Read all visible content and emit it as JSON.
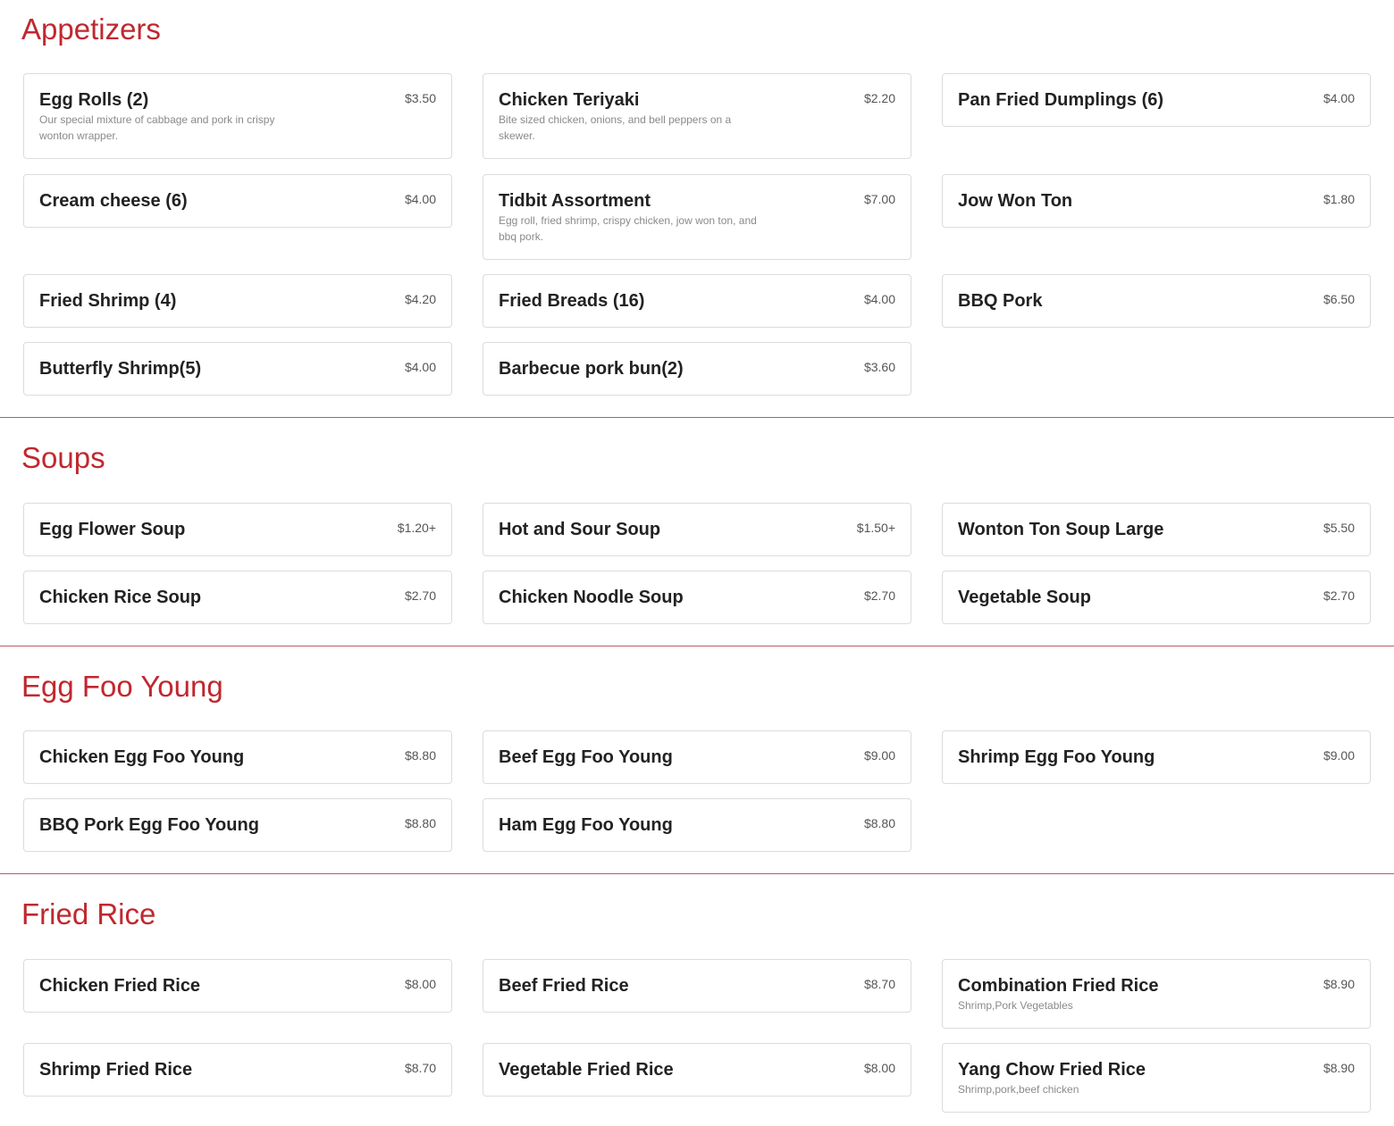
{
  "sections": {
    "appetizers": {
      "title": "Appetizers",
      "items": [
        {
          "name": "Egg Rolls (2)",
          "price": "$3.50",
          "desc": "Our special mixture of cabbage and pork in crispy wonton wrapper."
        },
        {
          "name": "Chicken Teriyaki",
          "price": "$2.20",
          "desc": "Bite sized chicken, onions, and bell peppers on a skewer."
        },
        {
          "name": "Pan Fried Dumplings (6)",
          "price": "$4.00"
        },
        {
          "name": "Cream cheese (6)",
          "price": "$4.00"
        },
        {
          "name": "Tidbit Assortment",
          "price": "$7.00",
          "desc": "Egg roll, fried shrimp, crispy chicken, jow won ton, and bbq pork."
        },
        {
          "name": "Jow Won Ton",
          "price": "$1.80"
        },
        {
          "name": "Fried Shrimp (4)",
          "price": "$4.20"
        },
        {
          "name": "Fried Breads (16)",
          "price": "$4.00"
        },
        {
          "name": "BBQ Pork",
          "price": "$6.50"
        },
        {
          "name": "Butterfly Shrimp(5)",
          "price": "$4.00"
        },
        {
          "name": "Barbecue pork bun(2)",
          "price": "$3.60"
        }
      ]
    },
    "soups": {
      "title": "Soups",
      "items": [
        {
          "name": "Egg Flower Soup",
          "price": "$1.20+"
        },
        {
          "name": "Hot and Sour Soup",
          "price": "$1.50+"
        },
        {
          "name": "Wonton Ton Soup Large",
          "price": "$5.50"
        },
        {
          "name": "Chicken Rice Soup",
          "price": "$2.70"
        },
        {
          "name": "Chicken Noodle Soup",
          "price": "$2.70"
        },
        {
          "name": "Vegetable Soup",
          "price": "$2.70"
        }
      ]
    },
    "egg_foo_young": {
      "title": "Egg Foo Young",
      "items": [
        {
          "name": "Chicken Egg Foo Young",
          "price": "$8.80"
        },
        {
          "name": "Beef Egg Foo Young",
          "price": "$9.00"
        },
        {
          "name": "Shrimp Egg Foo Young",
          "price": "$9.00"
        },
        {
          "name": "BBQ Pork Egg Foo Young",
          "price": "$8.80"
        },
        {
          "name": "Ham Egg Foo Young",
          "price": "$8.80"
        }
      ]
    },
    "fried_rice": {
      "title": "Fried Rice",
      "items": [
        {
          "name": "Chicken Fried Rice",
          "price": "$8.00"
        },
        {
          "name": "Beef Fried Rice",
          "price": "$8.70"
        },
        {
          "name": "Combination Fried Rice",
          "price": "$8.90",
          "desc": "Shrimp,Pork Vegetables"
        },
        {
          "name": "Shrimp Fried Rice",
          "price": "$8.70"
        },
        {
          "name": "Vegetable Fried Rice",
          "price": "$8.00"
        },
        {
          "name": "Yang Chow Fried Rice",
          "price": "$8.90",
          "desc": "Shrimp,pork,beef chicken"
        }
      ]
    }
  },
  "colors": {
    "section_title": "#c0282f",
    "divider": "#b85e63",
    "card_border": "#dcdcdc"
  }
}
